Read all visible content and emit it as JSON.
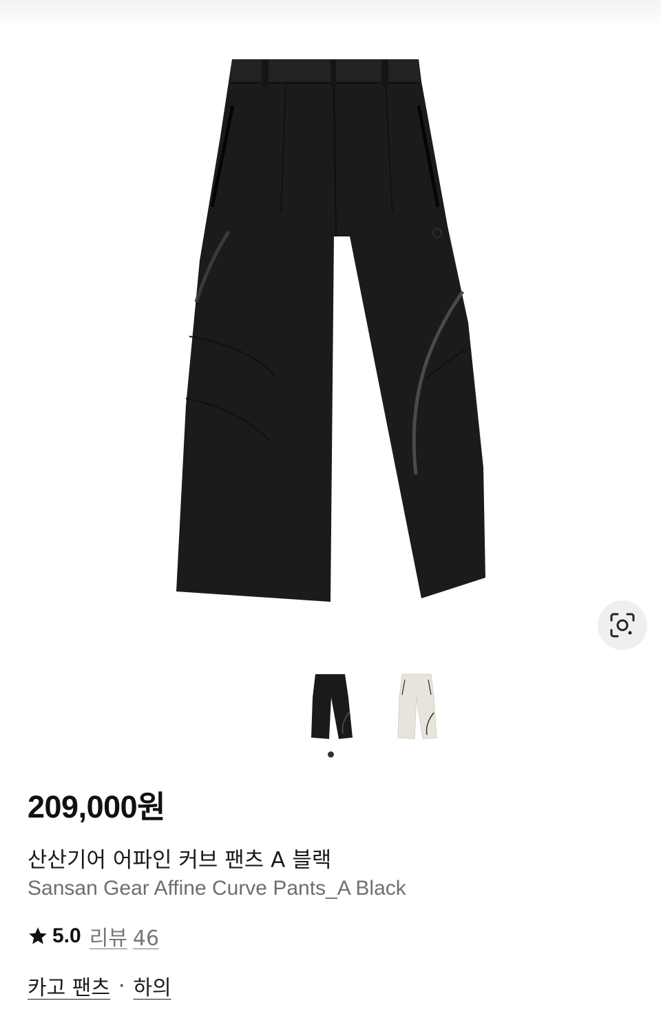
{
  "product": {
    "price": "209,000원",
    "name_ko": "산산기어 어파인 커브 팬츠 A 블랙",
    "name_en": "Sansan Gear Affine Curve Pants_A Black",
    "rating": "5.0",
    "review_label": "리뷰",
    "review_count": "46"
  },
  "gallery": {
    "main_image": "pants-black",
    "lens_icon": "image-search-icon",
    "thumbnails": [
      {
        "name": "pants-black",
        "color": "#1a1a1a",
        "selected": true
      },
      {
        "name": "pants-cream",
        "color": "#e8e4dc",
        "selected": false
      }
    ],
    "page_indicator": {
      "current": 1,
      "total": 1
    }
  },
  "categories": {
    "primary": "카고 팬츠",
    "separator": "·",
    "secondary": "하의"
  },
  "colors": {
    "text_primary": "#111111",
    "text_secondary": "#6e6e6e",
    "pants_black": "#1a1a1a",
    "pants_cream": "#e8e4dc"
  }
}
